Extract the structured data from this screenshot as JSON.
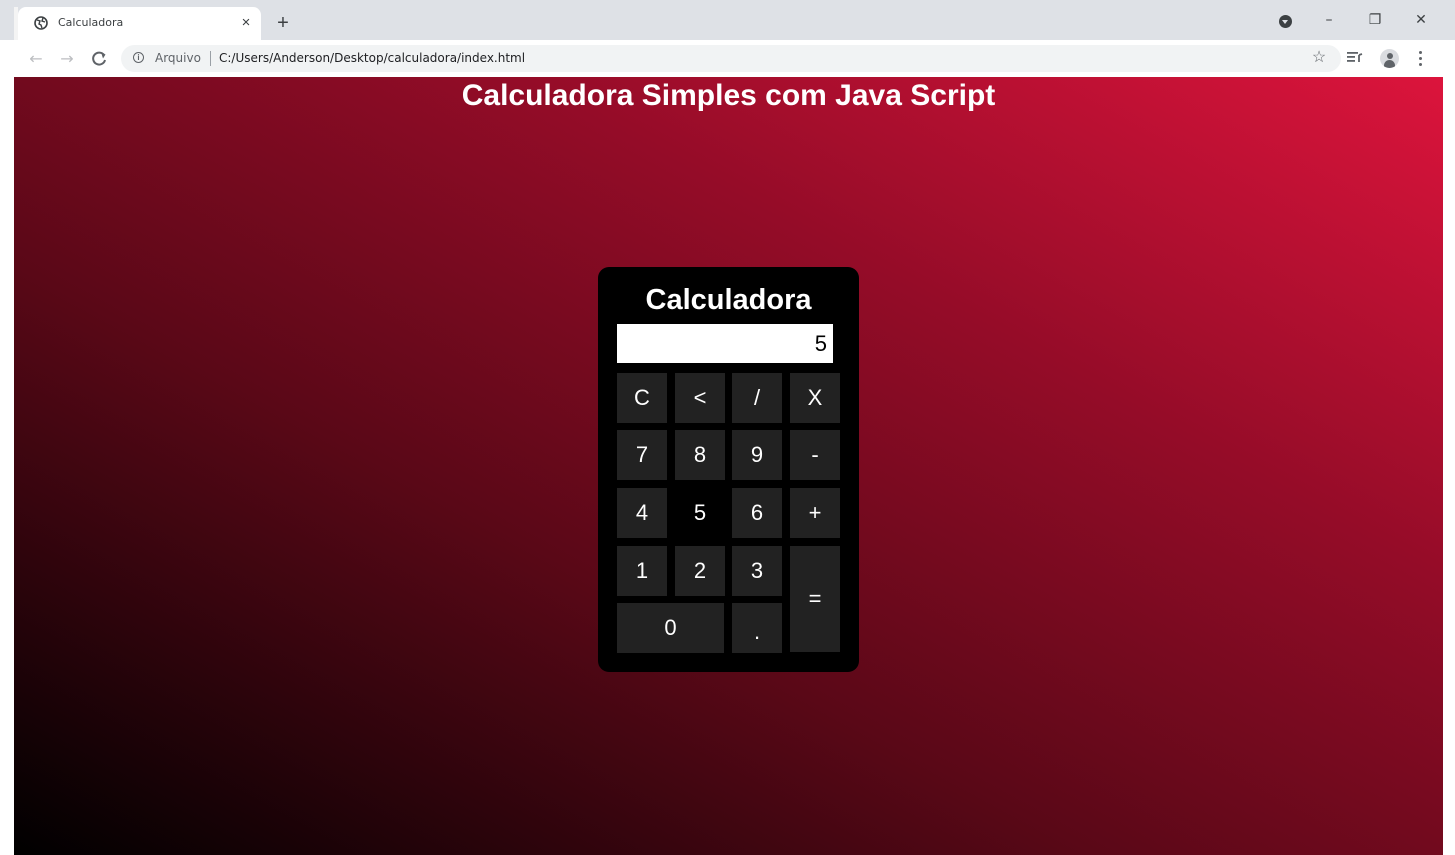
{
  "browser": {
    "tab_title": "Calculadora",
    "tab_close_glyph": "×",
    "new_tab_glyph": "+",
    "window_controls": {
      "minimize": "–",
      "restore": "❐",
      "close": "✕"
    },
    "nav": {
      "back": "←",
      "forward": "→",
      "reload": "C"
    },
    "security_label": "Arquivo",
    "url": "C:/Users/Anderson/Desktop/calculadora/index.html",
    "star_glyph": "☆"
  },
  "page": {
    "heading": "Calculadora Simples com Java Script",
    "background_gradient": [
      "#000000",
      "#5a0817",
      "#950c28",
      "#dc143c"
    ]
  },
  "calculator": {
    "title": "Calculadora",
    "display_value": "5",
    "keys": {
      "clear": "C",
      "backspace": "<",
      "divide": "/",
      "multiply": "X",
      "seven": "7",
      "eight": "8",
      "nine": "9",
      "minus": "-",
      "four": "4",
      "five": "5",
      "six": "6",
      "plus": "+",
      "one": "1",
      "two": "2",
      "three": "3",
      "equals": "=",
      "zero": "0",
      "decimal": "."
    },
    "key_color": "#222222",
    "panel_color": "#000000"
  }
}
